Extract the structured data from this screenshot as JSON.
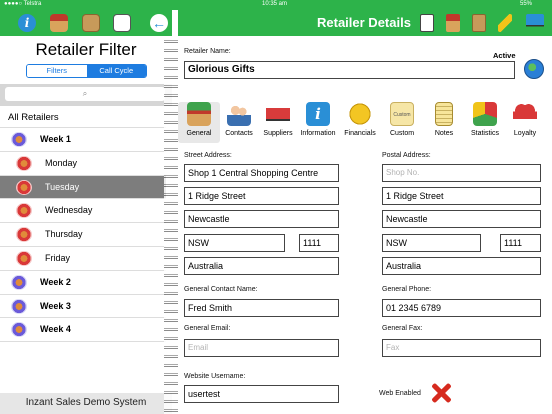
{
  "status_bar": {
    "carrier": "●●●●○ Telstra",
    "time": "10:35 am",
    "battery": "55%"
  },
  "left_toolbar": {
    "icons": [
      "info-icon",
      "store-icon",
      "box-icon",
      "calendar-icon",
      "back-arrow-icon"
    ]
  },
  "filter": {
    "title": "Retailer Filter",
    "segments": [
      "Filters",
      "Call Cycle"
    ],
    "selected_segment": "Call Cycle",
    "search_icon": "⌕"
  },
  "list": {
    "all_label": "All Retailers",
    "items": [
      {
        "label": "Week 1",
        "kind": "week"
      },
      {
        "label": "Monday",
        "kind": "day"
      },
      {
        "label": "Tuesday",
        "kind": "day",
        "selected": true
      },
      {
        "label": "Wednesday",
        "kind": "day"
      },
      {
        "label": "Thursday",
        "kind": "day"
      },
      {
        "label": "Friday",
        "kind": "day"
      },
      {
        "label": "Week 2",
        "kind": "week"
      },
      {
        "label": "Week 3",
        "kind": "week"
      },
      {
        "label": "Week 4",
        "kind": "week"
      }
    ]
  },
  "left_footer": "Inzant Sales Demo System",
  "header": {
    "title": "Retailer Details",
    "icons": [
      "print-icon",
      "store-icon",
      "box-icon",
      "pencil-icon",
      "truck-icon"
    ]
  },
  "retailer": {
    "name_label": "Retailer Name:",
    "name": "Glorious Gifts",
    "active_label": "Active"
  },
  "tabs": [
    "General",
    "Contacts",
    "Suppliers",
    "Information",
    "Financials",
    "Custom",
    "Notes",
    "Statistics",
    "Loyalty"
  ],
  "selected_tab": "General",
  "custom_icon_text": "Custom",
  "street": {
    "label": "Street Address:",
    "line1": "Shop 1 Central Shopping Centre",
    "line2": "1 Ridge Street",
    "city": "Newcastle",
    "state": "NSW",
    "postcode": "1111",
    "country": "Australia"
  },
  "postal": {
    "label": "Postal Address:",
    "line1_placeholder": "Shop No.",
    "line2": "1 Ridge Street",
    "city": "Newcastle",
    "state": "NSW",
    "postcode": "1111",
    "country": "Australia"
  },
  "contact": {
    "name_label": "General Contact Name:",
    "name": "Fred Smith",
    "phone_label": "General Phone:",
    "phone": "01 2345 6789",
    "email_label": "General Email:",
    "email_placeholder": "Email",
    "fax_label": "General Fax:",
    "fax_placeholder": "Fax"
  },
  "website": {
    "username_label": "Website Username:",
    "username": "usertest",
    "web_enabled_label": "Web Enabled",
    "web_enabled": false
  },
  "colors": {
    "toolbar_green": "#2db34a",
    "accent_blue": "#1e7ce0",
    "selected_row": "#7d7d7d"
  }
}
